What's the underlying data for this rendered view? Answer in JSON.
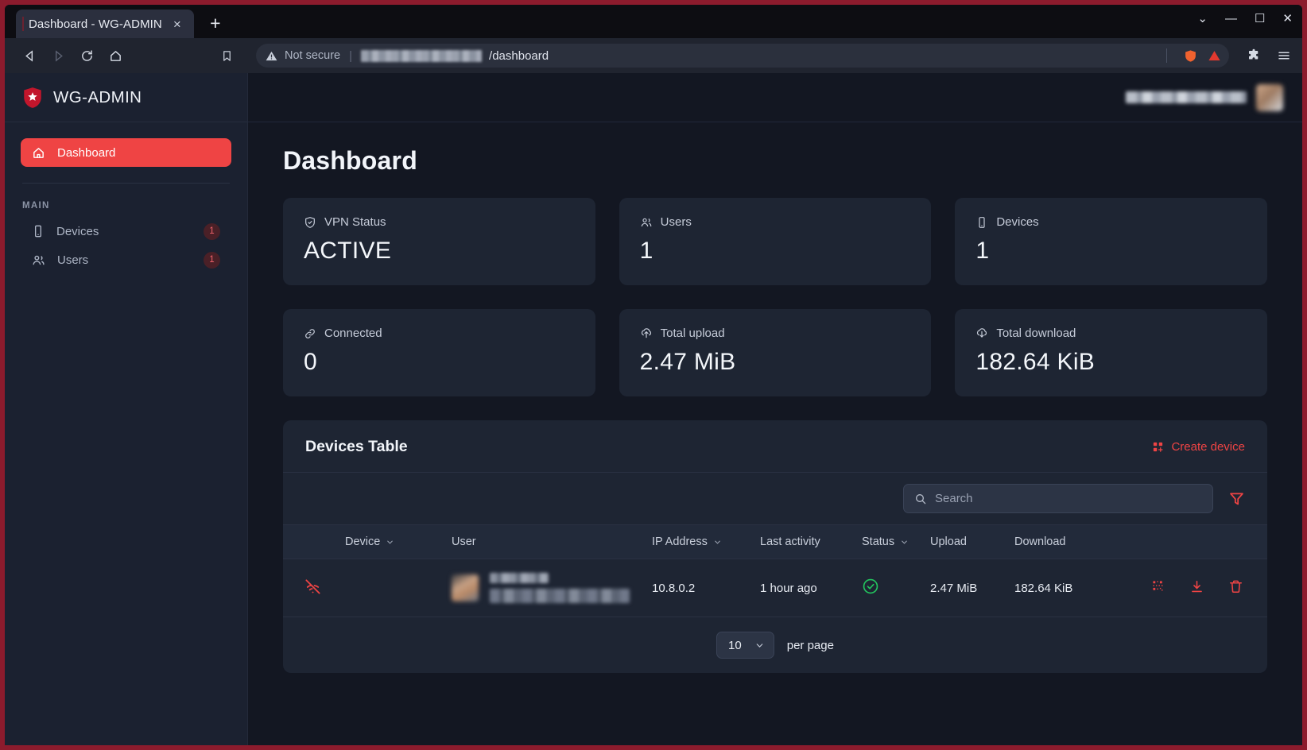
{
  "browser": {
    "tab_title": "Dashboard - WG-ADMIN",
    "close_label": "×",
    "new_tab_label": "+",
    "security_label": "Not secure",
    "url_path": "/dashboard",
    "url_redacted": true,
    "window_minimize": "—",
    "window_maximize": "☐",
    "window_close": "✕",
    "window_more": "⌄"
  },
  "sidebar": {
    "brand": "WG-ADMIN",
    "logo_icon": "shield-star-icon",
    "primary": [
      {
        "label": "Dashboard",
        "icon": "home-icon",
        "active": true
      }
    ],
    "section_label": "MAIN",
    "items": [
      {
        "label": "Devices",
        "icon": "device-phone-icon",
        "badge": "1"
      },
      {
        "label": "Users",
        "icon": "users-icon",
        "badge": "1"
      }
    ]
  },
  "topbar": {
    "user_name_redacted": true,
    "avatar_redacted": true
  },
  "main": {
    "page_title": "Dashboard",
    "stats": [
      {
        "label": "VPN Status",
        "value": "ACTIVE",
        "icon": "shield-check-icon"
      },
      {
        "label": "Users",
        "value": "1",
        "icon": "users-icon"
      },
      {
        "label": "Devices",
        "value": "1",
        "icon": "device-phone-icon"
      },
      {
        "label": "Connected",
        "value": "0",
        "icon": "link-icon"
      },
      {
        "label": "Total upload",
        "value": "2.47 MiB",
        "icon": "upload-circle-icon"
      },
      {
        "label": "Total download",
        "value": "182.64 KiB",
        "icon": "download-circle-icon"
      }
    ]
  },
  "table": {
    "title": "Devices Table",
    "create_label": "Create device",
    "create_icon": "grid-plus-icon",
    "search_placeholder": "Search",
    "search_value": "",
    "filter_icon": "funnel-icon",
    "columns": [
      {
        "label": "",
        "sortable": false
      },
      {
        "label": "Device",
        "sortable": true
      },
      {
        "label": "User",
        "sortable": false
      },
      {
        "label": "IP Address",
        "sortable": true
      },
      {
        "label": "Last activity",
        "sortable": false
      },
      {
        "label": "Status",
        "sortable": true
      },
      {
        "label": "Upload",
        "sortable": false
      },
      {
        "label": "Download",
        "sortable": false
      },
      {
        "label": "",
        "sortable": false
      }
    ],
    "rows": [
      {
        "connection_icon": "wifi-off-icon",
        "device_redacted": true,
        "user_redacted": true,
        "ip_address": "10.8.0.2",
        "last_activity": "1 hour ago",
        "status_icon": "check-circle-icon",
        "upload": "2.47 MiB",
        "download": "182.64 KiB",
        "actions": [
          "qr-code-icon",
          "download-icon",
          "trash-icon"
        ]
      }
    ],
    "per_page_value": "10",
    "per_page_label": "per page"
  },
  "colors": {
    "accent_red": "#ef4444",
    "status_green": "#22c55e",
    "panel_bg": "#1e2533",
    "page_bg": "#131722",
    "sidebar_bg": "#1b2130"
  }
}
